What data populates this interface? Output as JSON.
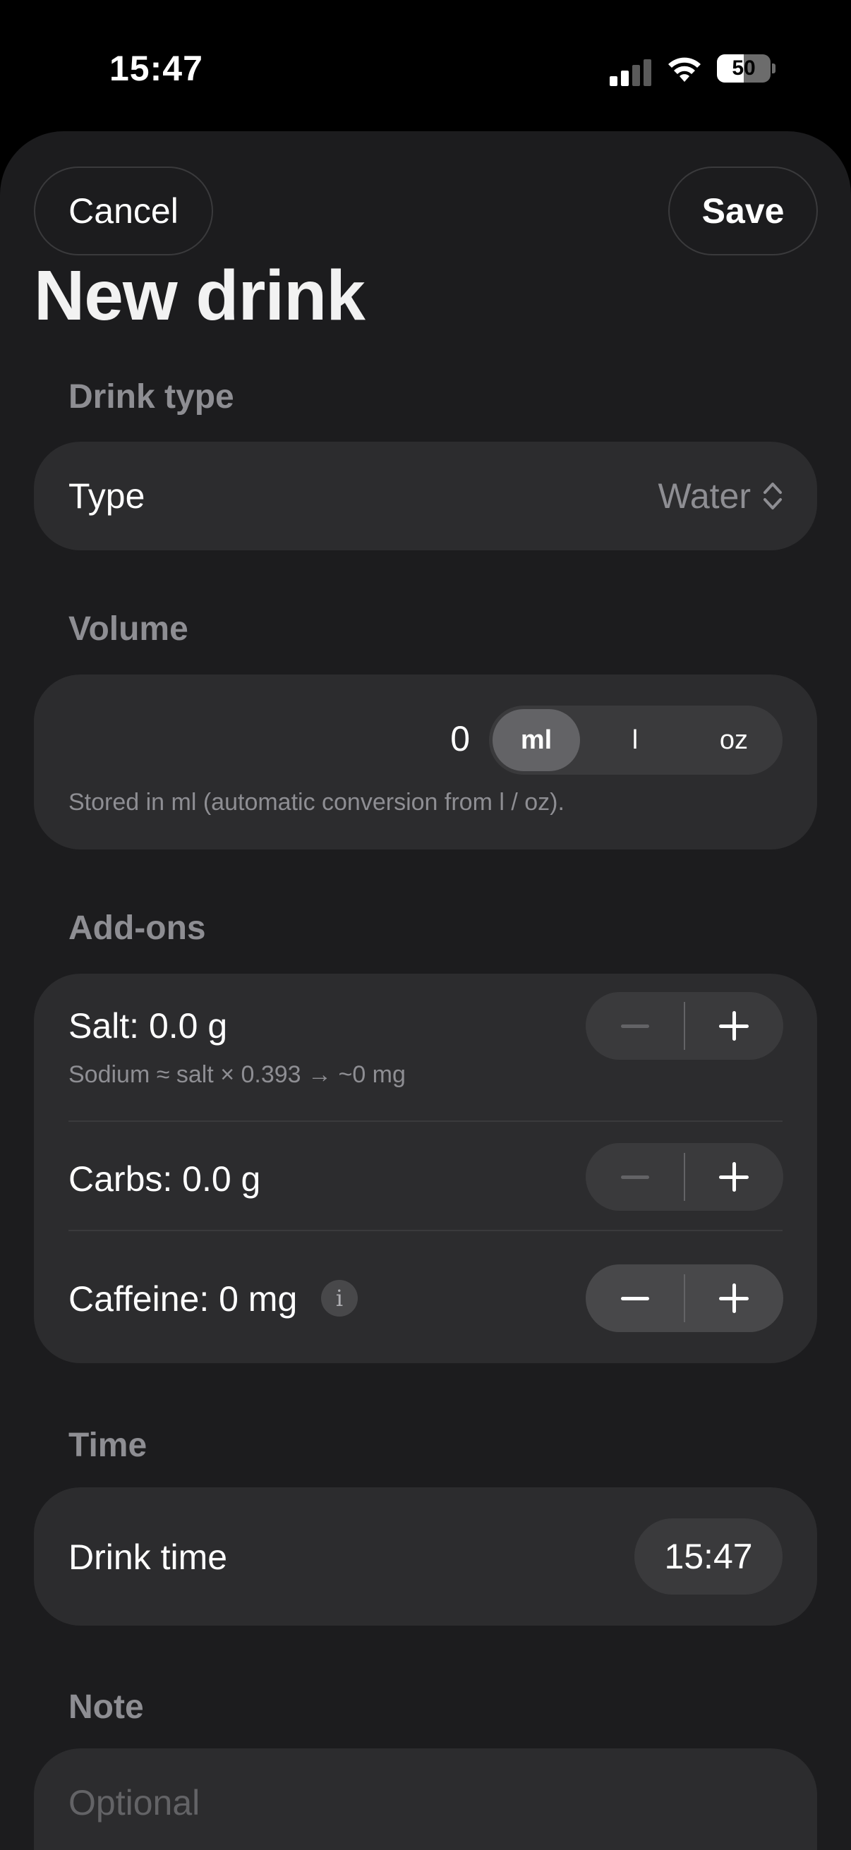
{
  "status_bar": {
    "time": "15:47",
    "battery_level": "50",
    "battery_fraction": 0.5
  },
  "header": {
    "cancel_label": "Cancel",
    "save_label": "Save",
    "title": "New drink"
  },
  "drink_type": {
    "section": "Drink type",
    "label": "Type",
    "value": "Water",
    "icon": "chevron-up-down-icon"
  },
  "volume": {
    "section": "Volume",
    "value": "0",
    "units": [
      "ml",
      "l",
      "oz"
    ],
    "selected_unit": "ml",
    "hint": "Stored in ml (automatic conversion from l / oz)."
  },
  "addons": {
    "section": "Add-ons",
    "salt": {
      "label": "Salt: 0.0 g",
      "sub": "Sodium ≈ salt × 0.393 → ~0 mg"
    },
    "carbs": {
      "label": "Carbs: 0.0 g"
    },
    "caffeine": {
      "label": "Caffeine: 0 mg",
      "info": "i"
    },
    "minus_symbol": "−",
    "plus_symbol": "+"
  },
  "time": {
    "section": "Time",
    "label": "Drink time",
    "value": "15:47"
  },
  "note": {
    "section": "Note",
    "placeholder": "Optional"
  },
  "colors": {
    "sheet_bg": "#1c1c1e",
    "card_bg": "#2c2c2e",
    "secondary_text": "#8e8e93"
  }
}
